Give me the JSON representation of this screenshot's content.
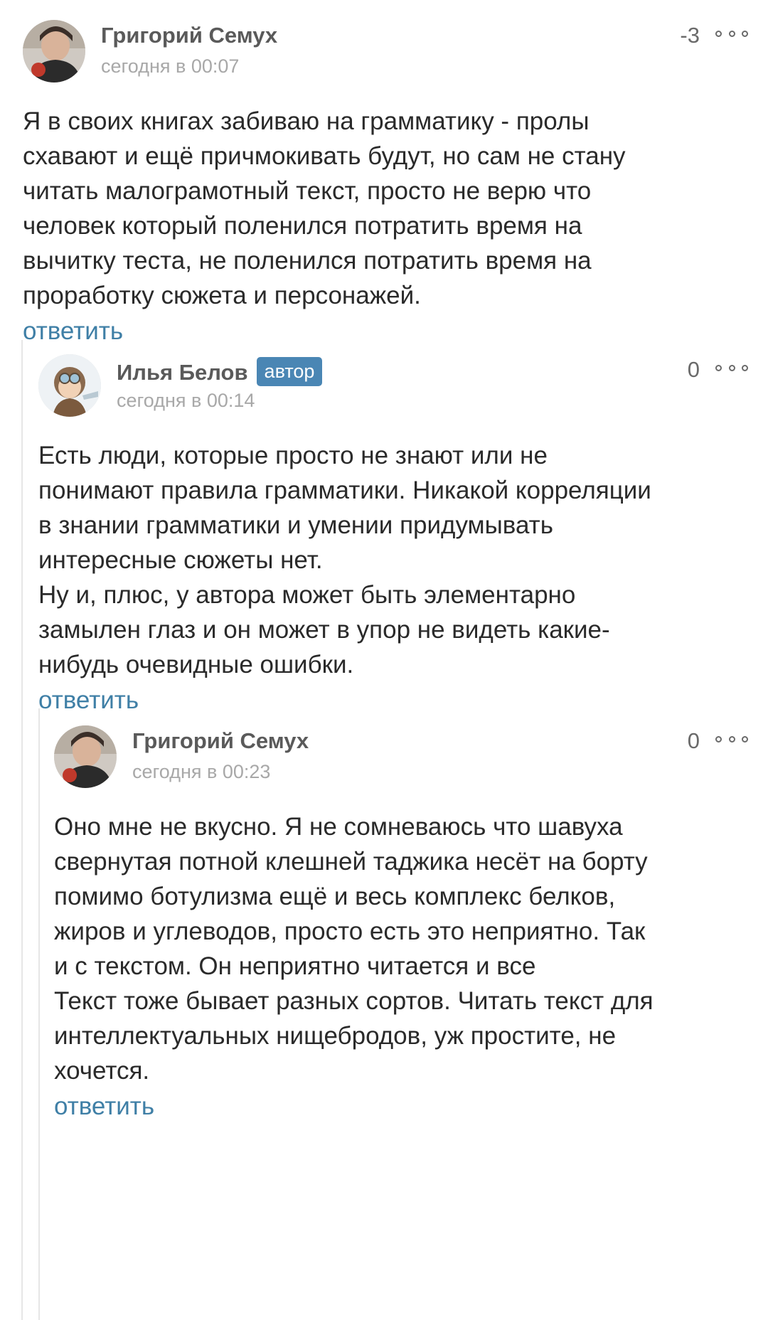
{
  "comments": [
    {
      "author": "Григорий Семух",
      "time": "сегодня в 00:07",
      "rating": "-3",
      "reply_label": "ответить",
      "lines": [
        "Я в своих книгах забиваю на грамматику - пролы",
        "схавают и ещё причмокивать будут, но сам не стану",
        "читать малограмотный текст, просто не верю что",
        "человек который поленился потратить время на",
        "вычитку теста, не поленился потратить время на",
        "проработку сюжета и персонажей."
      ]
    },
    {
      "author": "Илья Белов",
      "badge": "автор",
      "time": "сегодня в 00:14",
      "rating": "0",
      "reply_label": "ответить",
      "lines": [
        "Есть люди, которые просто не знают или не",
        "понимают правила грамматики. Никакой корреляции",
        "в знании грамматики и умении придумывать",
        "интересные сюжеты нет.",
        "Ну и, плюс, у автора может быть элементарно",
        "замылен глаз и он может в упор не видеть какие-",
        "нибудь очевидные ошибки."
      ]
    },
    {
      "author": "Григорий Семух",
      "time": "сегодня в 00:23",
      "rating": "0",
      "reply_label": "ответить",
      "lines": [
        "Оно мне не вкусно. Я не сомневаюсь что шавуха",
        "свернутая потной клешней таджика несёт на борту",
        "помимо ботулизма ещё и весь комплекс белков,",
        "жиров и углеводов, просто есть это неприятно. Так",
        "и с текстом. Он неприятно читается и все",
        "Текст тоже бывает разных сортов. Читать текст для",
        "интеллектуальных нищебродов, уж простите, не",
        "хочется."
      ]
    }
  ],
  "colors": {
    "author": "#5a5a5a",
    "time": "#a8a8a8",
    "reply": "#3f7fa6",
    "badge": "#4a86b4",
    "thread_line": "#e6e6e6"
  }
}
